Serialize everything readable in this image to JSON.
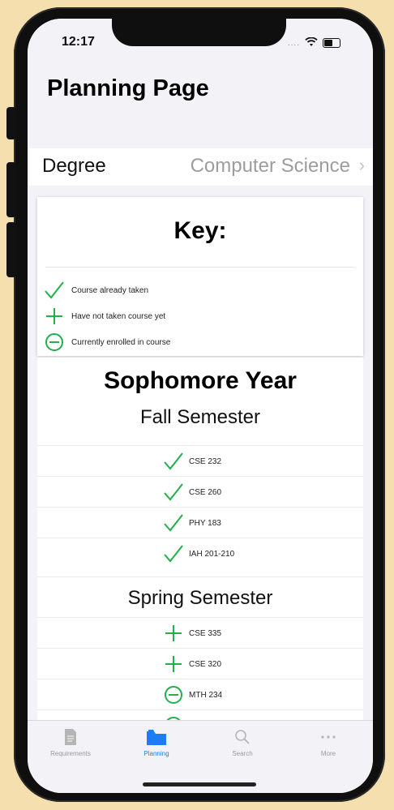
{
  "status": {
    "time": "12:17",
    "signal": "...."
  },
  "page_title": "Planning Page",
  "degree": {
    "label": "Degree",
    "value": "Computer Science",
    "chevron": "›"
  },
  "key": {
    "title": "Key:",
    "items": [
      {
        "icon": "check-icon",
        "text": "Course already taken"
      },
      {
        "icon": "plus-icon",
        "text": "Have not taken course yet"
      },
      {
        "icon": "minus-circle-icon",
        "text": "Currently enrolled in course"
      }
    ]
  },
  "year": {
    "title": "Sophomore Year",
    "semesters": [
      {
        "title": "Fall Semester",
        "courses": [
          {
            "icon": "check-icon",
            "code": "CSE 232"
          },
          {
            "icon": "check-icon",
            "code": "CSE 260"
          },
          {
            "icon": "check-icon",
            "code": "PHY 183"
          },
          {
            "icon": "check-icon",
            "code": "IAH 201-210"
          }
        ]
      },
      {
        "title": "Spring Semester",
        "courses": [
          {
            "icon": "plus-icon",
            "code": "CSE 335"
          },
          {
            "icon": "plus-icon",
            "code": "CSE 320"
          },
          {
            "icon": "minus-circle-icon",
            "code": "MTH 234"
          }
        ]
      }
    ]
  },
  "tabs": [
    {
      "label": "Requirements",
      "icon": "document-icon",
      "active": false
    },
    {
      "label": "Planning",
      "icon": "folder-icon",
      "active": true
    },
    {
      "label": "Search",
      "icon": "search-icon",
      "active": false
    },
    {
      "label": "More",
      "icon": "more-icon",
      "active": false
    }
  ],
  "colors": {
    "green": "#21b04b",
    "accent": "#1b7cf3",
    "frame": "#0f0f0f",
    "background": "#f5dfae"
  }
}
